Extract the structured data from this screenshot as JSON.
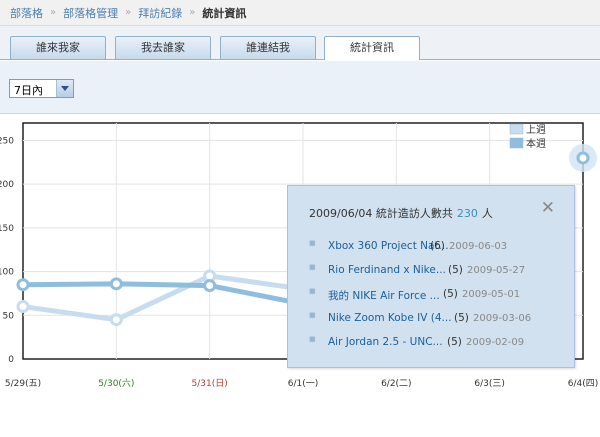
{
  "breadcrumb": [
    "部落格",
    "部落格管理",
    "拜訪紀錄",
    "統計資訊"
  ],
  "tabs": [
    "誰來我家",
    "我去誰家",
    "誰連結我",
    "統計資訊"
  ],
  "filter": {
    "selected": "7日內"
  },
  "chart_data": {
    "type": "line",
    "categories": [
      "5/29(五)",
      "5/30(六)",
      "5/31(日)",
      "6/1(一)",
      "6/2(二)",
      "6/3(三)",
      "6/4(四)"
    ],
    "category_colors": [
      "#333333",
      "#2e7d1f",
      "#c0392b",
      "#333333",
      "#333333",
      "#333333",
      "#333333"
    ],
    "yticks": [
      0,
      50,
      100,
      150,
      200,
      250
    ],
    "ylim": [
      0,
      270
    ],
    "series": [
      {
        "name": "上週",
        "color": "#c7dcef",
        "values": [
          60,
          45,
          95,
          80,
          null,
          null,
          null
        ]
      },
      {
        "name": "本週",
        "color": "#8fbde0",
        "values": [
          85,
          86,
          84,
          63,
          null,
          null,
          230
        ]
      }
    ],
    "highlight_index": 6
  },
  "popup": {
    "title": "2009/06/04 統計造訪人數共",
    "count": "230",
    "unit": "人",
    "close": "✕",
    "posts": [
      {
        "title": "Xbox 360 Project Nat...",
        "count": "(6)",
        "date": "2009-06-03"
      },
      {
        "title": "Rio Ferdinand x Nike...",
        "count": "(5)",
        "date": "2009-05-27"
      },
      {
        "title": "我的 NIKE Air Force ...",
        "count": "(5)",
        "date": "2009-05-01"
      },
      {
        "title": "Nike Zoom Kobe IV (4...",
        "count": "(5)",
        "date": "2009-03-06"
      },
      {
        "title": "Air Jordan 2.5 - UNC...",
        "count": "(5)",
        "date": "2009-02-09"
      }
    ]
  }
}
